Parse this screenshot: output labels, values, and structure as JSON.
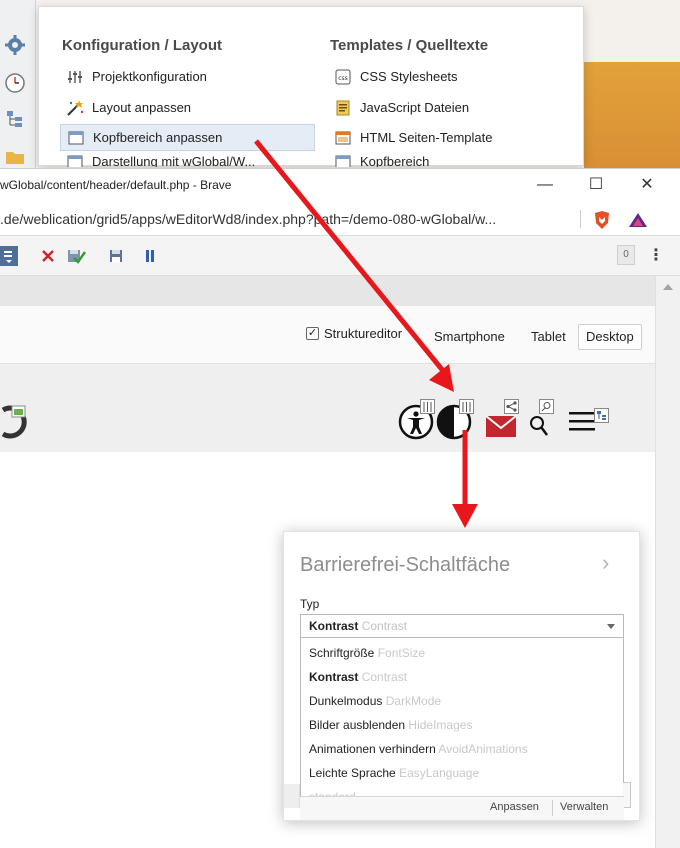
{
  "menu": {
    "col1_heading": "Konfiguration / Layout",
    "col2_heading": "Templates / Quelltexte",
    "col1_items": [
      {
        "label": "Projektkonfiguration",
        "icon": "sliders-icon"
      },
      {
        "label": "Layout anpassen",
        "icon": "magic-wand-icon"
      },
      {
        "label": "Kopfbereich anpassen",
        "icon": "window-icon",
        "active": true
      },
      {
        "label": "Darstellung mit wGlobal/W...",
        "icon": "window-icon"
      }
    ],
    "col2_items": [
      {
        "label": "CSS Stylesheets",
        "icon": "css-file-icon"
      },
      {
        "label": "JavaScript Dateien",
        "icon": "js-file-icon"
      },
      {
        "label": "HTML Seiten-Template",
        "icon": "html-template-icon"
      },
      {
        "label": "Kopfbereich",
        "icon": "window-icon"
      }
    ]
  },
  "browser": {
    "title": "wGlobal/content/header/default.php - Brave",
    "url": ".de/weblication/grid5/apps/wEditorWd8/index.php?path=/demo-080-wGlobal/w...",
    "minimize": "—",
    "maximize": "☐",
    "close": "✕",
    "counter": "0",
    "more": "⋮"
  },
  "viewbar": {
    "structure_editor": "Struktureditor",
    "checked_mark": "✓",
    "views": [
      "Smartphone",
      "Tablet",
      "Desktop"
    ],
    "selected_view": "Desktop"
  },
  "panel": {
    "title": "Barrierefrei-Schaltfäche",
    "next": "›",
    "type_label": "Typ",
    "selected": {
      "main": "Kontrast",
      "sub": "Contrast"
    },
    "options": [
      {
        "main": "Schriftgröße",
        "sub": "FontSize",
        "bold": false
      },
      {
        "main": "Kontrast",
        "sub": "Contrast",
        "bold": true
      },
      {
        "main": "Dunkelmodus",
        "sub": "DarkMode",
        "bold": false
      },
      {
        "main": "Bilder ausblenden",
        "sub": "HideImages",
        "bold": false
      },
      {
        "main": "Animationen verhindern",
        "sub": "AvoidAnimations",
        "bold": false
      },
      {
        "main": "Leichte Sprache",
        "sub": "EasyLanguage",
        "bold": false
      },
      {
        "main": "",
        "sub": "standard",
        "bold": false
      }
    ],
    "buttons": [
      "Anpassen",
      "Verwalten"
    ]
  },
  "colors": {
    "arrow": "#e8171c",
    "accent": "#3b6fb6",
    "mail": "#c1272d",
    "brave": "#e2502a"
  }
}
